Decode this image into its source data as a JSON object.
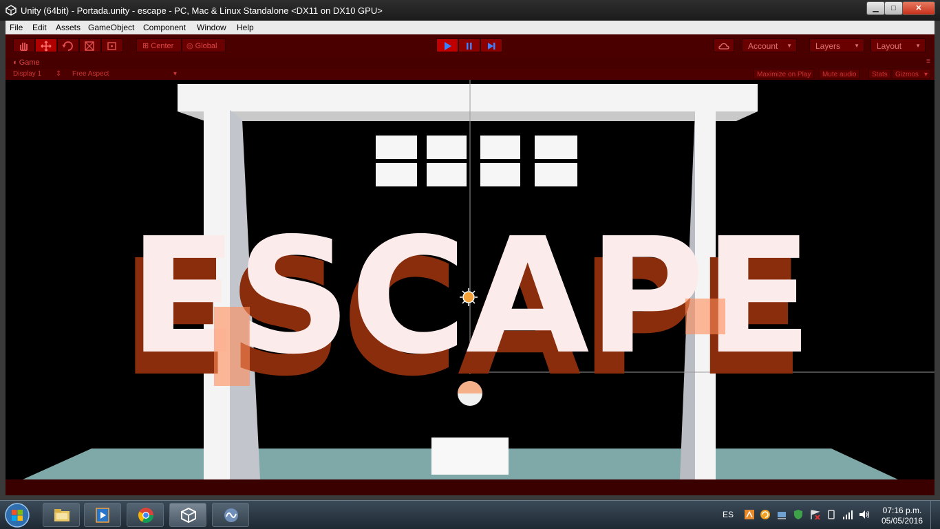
{
  "window": {
    "title": "Unity (64bit) - Portada.unity - escape - PC, Mac & Linux Standalone <DX11 on DX10 GPU>"
  },
  "menu": [
    "File",
    "Edit",
    "Assets",
    "GameObject",
    "Component",
    "Window",
    "Help"
  ],
  "toolbar": {
    "tools": [
      "hand-icon",
      "move-icon",
      "rotate-icon",
      "scale-icon",
      "rect-icon"
    ],
    "active_tool": "move-icon",
    "pivot_label": "Center",
    "space_label": "Global",
    "playmode": {
      "playing": true
    },
    "account_label": "Account",
    "layers_label": "Layers",
    "layout_label": "Layout"
  },
  "game_panel": {
    "tab_label": "Game",
    "display_label": "Display 1",
    "aspect_label": "Free Aspect",
    "maximize_label": "Maximize on Play",
    "mute_label": "Mute audio",
    "stats_label": "Stats",
    "gizmos_label": "Gizmos"
  },
  "scene": {
    "logo_text": "ESCAPE",
    "colors": {
      "logo_fill": "#fbeceb",
      "logo_shadow": "#8a2d0c",
      "floor": "#7fa8a8",
      "frame": "#f2f2f2",
      "tint": "#cc0000"
    }
  },
  "taskbar": {
    "apps": [
      "explorer-icon",
      "media-player-icon",
      "chrome-icon",
      "unity-icon",
      "monodevelop-icon"
    ],
    "active_app": "unity-icon",
    "language": "ES",
    "time": "07:16 p.m.",
    "date": "05/05/2016"
  }
}
